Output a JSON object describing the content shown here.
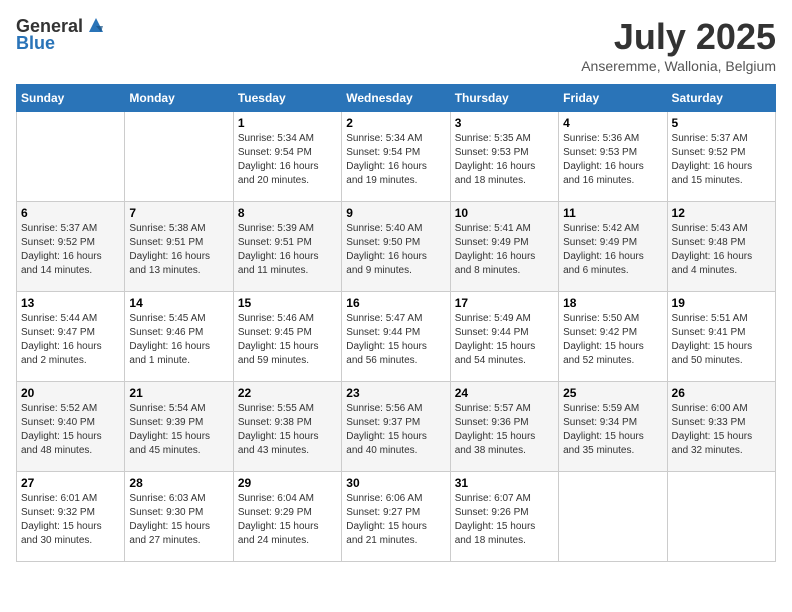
{
  "header": {
    "logo_line1": "General",
    "logo_line2": "Blue",
    "month": "July 2025",
    "location": "Anseremme, Wallonia, Belgium"
  },
  "weekdays": [
    "Sunday",
    "Monday",
    "Tuesday",
    "Wednesday",
    "Thursday",
    "Friday",
    "Saturday"
  ],
  "weeks": [
    [
      {
        "day": "",
        "info": ""
      },
      {
        "day": "",
        "info": ""
      },
      {
        "day": "1",
        "info": "Sunrise: 5:34 AM\nSunset: 9:54 PM\nDaylight: 16 hours\nand 20 minutes."
      },
      {
        "day": "2",
        "info": "Sunrise: 5:34 AM\nSunset: 9:54 PM\nDaylight: 16 hours\nand 19 minutes."
      },
      {
        "day": "3",
        "info": "Sunrise: 5:35 AM\nSunset: 9:53 PM\nDaylight: 16 hours\nand 18 minutes."
      },
      {
        "day": "4",
        "info": "Sunrise: 5:36 AM\nSunset: 9:53 PM\nDaylight: 16 hours\nand 16 minutes."
      },
      {
        "day": "5",
        "info": "Sunrise: 5:37 AM\nSunset: 9:52 PM\nDaylight: 16 hours\nand 15 minutes."
      }
    ],
    [
      {
        "day": "6",
        "info": "Sunrise: 5:37 AM\nSunset: 9:52 PM\nDaylight: 16 hours\nand 14 minutes."
      },
      {
        "day": "7",
        "info": "Sunrise: 5:38 AM\nSunset: 9:51 PM\nDaylight: 16 hours\nand 13 minutes."
      },
      {
        "day": "8",
        "info": "Sunrise: 5:39 AM\nSunset: 9:51 PM\nDaylight: 16 hours\nand 11 minutes."
      },
      {
        "day": "9",
        "info": "Sunrise: 5:40 AM\nSunset: 9:50 PM\nDaylight: 16 hours\nand 9 minutes."
      },
      {
        "day": "10",
        "info": "Sunrise: 5:41 AM\nSunset: 9:49 PM\nDaylight: 16 hours\nand 8 minutes."
      },
      {
        "day": "11",
        "info": "Sunrise: 5:42 AM\nSunset: 9:49 PM\nDaylight: 16 hours\nand 6 minutes."
      },
      {
        "day": "12",
        "info": "Sunrise: 5:43 AM\nSunset: 9:48 PM\nDaylight: 16 hours\nand 4 minutes."
      }
    ],
    [
      {
        "day": "13",
        "info": "Sunrise: 5:44 AM\nSunset: 9:47 PM\nDaylight: 16 hours\nand 2 minutes."
      },
      {
        "day": "14",
        "info": "Sunrise: 5:45 AM\nSunset: 9:46 PM\nDaylight: 16 hours\nand 1 minute."
      },
      {
        "day": "15",
        "info": "Sunrise: 5:46 AM\nSunset: 9:45 PM\nDaylight: 15 hours\nand 59 minutes."
      },
      {
        "day": "16",
        "info": "Sunrise: 5:47 AM\nSunset: 9:44 PM\nDaylight: 15 hours\nand 56 minutes."
      },
      {
        "day": "17",
        "info": "Sunrise: 5:49 AM\nSunset: 9:44 PM\nDaylight: 15 hours\nand 54 minutes."
      },
      {
        "day": "18",
        "info": "Sunrise: 5:50 AM\nSunset: 9:42 PM\nDaylight: 15 hours\nand 52 minutes."
      },
      {
        "day": "19",
        "info": "Sunrise: 5:51 AM\nSunset: 9:41 PM\nDaylight: 15 hours\nand 50 minutes."
      }
    ],
    [
      {
        "day": "20",
        "info": "Sunrise: 5:52 AM\nSunset: 9:40 PM\nDaylight: 15 hours\nand 48 minutes."
      },
      {
        "day": "21",
        "info": "Sunrise: 5:54 AM\nSunset: 9:39 PM\nDaylight: 15 hours\nand 45 minutes."
      },
      {
        "day": "22",
        "info": "Sunrise: 5:55 AM\nSunset: 9:38 PM\nDaylight: 15 hours\nand 43 minutes."
      },
      {
        "day": "23",
        "info": "Sunrise: 5:56 AM\nSunset: 9:37 PM\nDaylight: 15 hours\nand 40 minutes."
      },
      {
        "day": "24",
        "info": "Sunrise: 5:57 AM\nSunset: 9:36 PM\nDaylight: 15 hours\nand 38 minutes."
      },
      {
        "day": "25",
        "info": "Sunrise: 5:59 AM\nSunset: 9:34 PM\nDaylight: 15 hours\nand 35 minutes."
      },
      {
        "day": "26",
        "info": "Sunrise: 6:00 AM\nSunset: 9:33 PM\nDaylight: 15 hours\nand 32 minutes."
      }
    ],
    [
      {
        "day": "27",
        "info": "Sunrise: 6:01 AM\nSunset: 9:32 PM\nDaylight: 15 hours\nand 30 minutes."
      },
      {
        "day": "28",
        "info": "Sunrise: 6:03 AM\nSunset: 9:30 PM\nDaylight: 15 hours\nand 27 minutes."
      },
      {
        "day": "29",
        "info": "Sunrise: 6:04 AM\nSunset: 9:29 PM\nDaylight: 15 hours\nand 24 minutes."
      },
      {
        "day": "30",
        "info": "Sunrise: 6:06 AM\nSunset: 9:27 PM\nDaylight: 15 hours\nand 21 minutes."
      },
      {
        "day": "31",
        "info": "Sunrise: 6:07 AM\nSunset: 9:26 PM\nDaylight: 15 hours\nand 18 minutes."
      },
      {
        "day": "",
        "info": ""
      },
      {
        "day": "",
        "info": ""
      }
    ]
  ]
}
